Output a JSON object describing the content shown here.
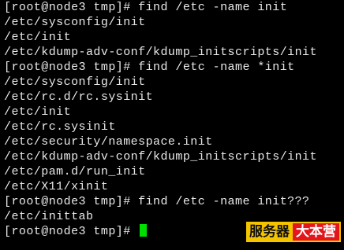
{
  "terminal": {
    "prompt": "[root@node3 tmp]# ",
    "lines": [
      "[root@node3 tmp]# find /etc -name init",
      "/etc/sysconfig/init",
      "/etc/init",
      "/etc/kdump-adv-conf/kdump_initscripts/init",
      "[root@node3 tmp]# find /etc -name *init",
      "/etc/sysconfig/init",
      "/etc/rc.d/rc.sysinit",
      "/etc/init",
      "/etc/rc.sysinit",
      "/etc/security/namespace.init",
      "/etc/kdump-adv-conf/kdump_initscripts/init",
      "/etc/pam.d/run_init",
      "/etc/X11/xinit",
      "[root@node3 tmp]# find /etc -name init???",
      "/etc/inittab"
    ],
    "cursor_color": "#00e000",
    "text_color": "#e8e8e8",
    "background": "#000000"
  },
  "watermark": {
    "part1": "服务器",
    "part2": "大本营",
    "part1_bg": "#f5c400",
    "part2_bg": "#e3161b"
  }
}
